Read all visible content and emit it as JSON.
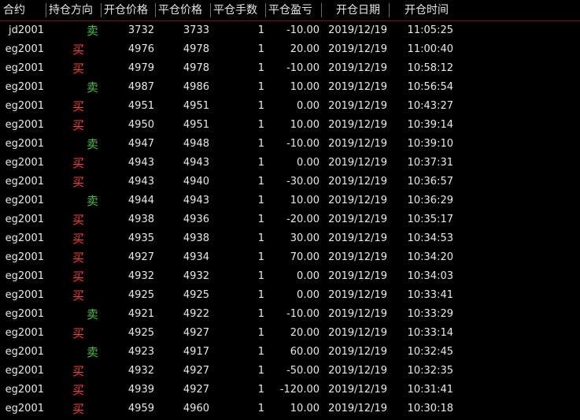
{
  "headers": [
    "合约",
    "持仓方向",
    "开仓价格",
    "平仓价格",
    "平仓手数",
    "平仓盈亏",
    "开仓日期",
    "开仓时间"
  ],
  "colors": {
    "buy": "#ff3b3b",
    "sell": "#3fbf3f",
    "header_line": "#7a1616"
  },
  "rows": [
    {
      "code": "jd2001",
      "dir": "卖",
      "side": "sell",
      "open": "3732",
      "close": "3733",
      "qty": "1",
      "pnl": "-10.00",
      "date": "2019/12/19",
      "time": "11:05:25"
    },
    {
      "code": "eg2001",
      "dir": "买",
      "side": "buy",
      "open": "4976",
      "close": "4978",
      "qty": "1",
      "pnl": "20.00",
      "date": "2019/12/19",
      "time": "11:00:40"
    },
    {
      "code": "eg2001",
      "dir": "买",
      "side": "buy",
      "open": "4979",
      "close": "4978",
      "qty": "1",
      "pnl": "-10.00",
      "date": "2019/12/19",
      "time": "10:58:12"
    },
    {
      "code": "eg2001",
      "dir": "卖",
      "side": "sell",
      "open": "4987",
      "close": "4986",
      "qty": "1",
      "pnl": "10.00",
      "date": "2019/12/19",
      "time": "10:56:54"
    },
    {
      "code": "eg2001",
      "dir": "买",
      "side": "buy",
      "open": "4951",
      "close": "4951",
      "qty": "1",
      "pnl": "0.00",
      "date": "2019/12/19",
      "time": "10:43:27"
    },
    {
      "code": "eg2001",
      "dir": "买",
      "side": "buy",
      "open": "4950",
      "close": "4951",
      "qty": "1",
      "pnl": "10.00",
      "date": "2019/12/19",
      "time": "10:39:14"
    },
    {
      "code": "eg2001",
      "dir": "卖",
      "side": "sell",
      "open": "4947",
      "close": "4948",
      "qty": "1",
      "pnl": "-10.00",
      "date": "2019/12/19",
      "time": "10:39:10"
    },
    {
      "code": "eg2001",
      "dir": "买",
      "side": "buy",
      "open": "4943",
      "close": "4943",
      "qty": "1",
      "pnl": "0.00",
      "date": "2019/12/19",
      "time": "10:37:31"
    },
    {
      "code": "eg2001",
      "dir": "买",
      "side": "buy",
      "open": "4943",
      "close": "4940",
      "qty": "1",
      "pnl": "-30.00",
      "date": "2019/12/19",
      "time": "10:36:57"
    },
    {
      "code": "eg2001",
      "dir": "卖",
      "side": "sell",
      "open": "4944",
      "close": "4943",
      "qty": "1",
      "pnl": "10.00",
      "date": "2019/12/19",
      "time": "10:36:29"
    },
    {
      "code": "eg2001",
      "dir": "买",
      "side": "buy",
      "open": "4938",
      "close": "4936",
      "qty": "1",
      "pnl": "-20.00",
      "date": "2019/12/19",
      "time": "10:35:17"
    },
    {
      "code": "eg2001",
      "dir": "买",
      "side": "buy",
      "open": "4935",
      "close": "4938",
      "qty": "1",
      "pnl": "30.00",
      "date": "2019/12/19",
      "time": "10:34:53"
    },
    {
      "code": "eg2001",
      "dir": "买",
      "side": "buy",
      "open": "4927",
      "close": "4934",
      "qty": "1",
      "pnl": "70.00",
      "date": "2019/12/19",
      "time": "10:34:20"
    },
    {
      "code": "eg2001",
      "dir": "买",
      "side": "buy",
      "open": "4932",
      "close": "4932",
      "qty": "1",
      "pnl": "0.00",
      "date": "2019/12/19",
      "time": "10:34:03"
    },
    {
      "code": "eg2001",
      "dir": "买",
      "side": "buy",
      "open": "4925",
      "close": "4925",
      "qty": "1",
      "pnl": "0.00",
      "date": "2019/12/19",
      "time": "10:33:41"
    },
    {
      "code": "eg2001",
      "dir": "卖",
      "side": "sell",
      "open": "4921",
      "close": "4922",
      "qty": "1",
      "pnl": "-10.00",
      "date": "2019/12/19",
      "time": "10:33:29"
    },
    {
      "code": "eg2001",
      "dir": "买",
      "side": "buy",
      "open": "4925",
      "close": "4927",
      "qty": "1",
      "pnl": "20.00",
      "date": "2019/12/19",
      "time": "10:33:14"
    },
    {
      "code": "eg2001",
      "dir": "卖",
      "side": "sell",
      "open": "4923",
      "close": "4917",
      "qty": "1",
      "pnl": "60.00",
      "date": "2019/12/19",
      "time": "10:32:45"
    },
    {
      "code": "eg2001",
      "dir": "买",
      "side": "buy",
      "open": "4932",
      "close": "4927",
      "qty": "1",
      "pnl": "-50.00",
      "date": "2019/12/19",
      "time": "10:32:35"
    },
    {
      "code": "eg2001",
      "dir": "买",
      "side": "buy",
      "open": "4939",
      "close": "4927",
      "qty": "1",
      "pnl": "-120.00",
      "date": "2019/12/19",
      "time": "10:31:41"
    },
    {
      "code": "eg2001",
      "dir": "买",
      "side": "buy",
      "open": "4959",
      "close": "4960",
      "qty": "1",
      "pnl": "10.00",
      "date": "2019/12/19",
      "time": "10:30:18"
    }
  ]
}
